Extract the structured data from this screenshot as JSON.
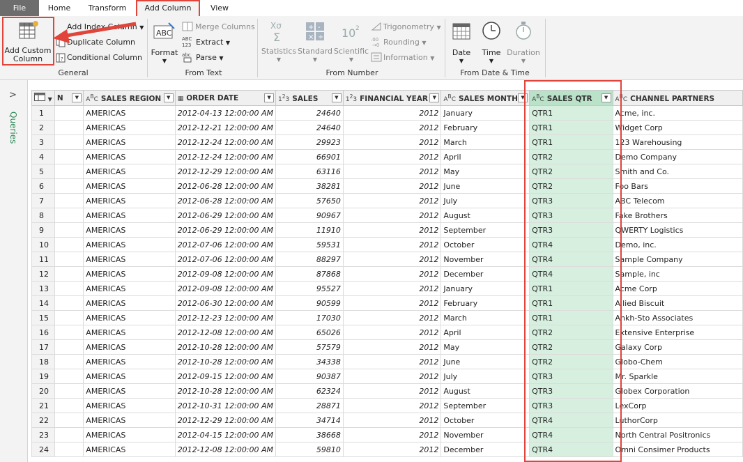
{
  "tabs": {
    "file": "File",
    "home": "Home",
    "transform": "Transform",
    "add_column": "Add Column",
    "view": "View"
  },
  "ribbon": {
    "general": {
      "label": "General",
      "add_custom_column": [
        "Add Custom",
        "Column"
      ],
      "index_column": "Add Index Column",
      "duplicate_column": "Duplicate Column",
      "conditional_column": "Conditional Column"
    },
    "from_text": {
      "label": "From Text",
      "format": "Format",
      "merge_columns": "Merge Columns",
      "extract": "Extract",
      "parse": "Parse"
    },
    "from_number": {
      "label": "From Number",
      "statistics": "Statistics",
      "standard": "Standard",
      "scientific": "Scientific",
      "trigonometry": "Trigonometry",
      "rounding": "Rounding",
      "information": "Information"
    },
    "from_datetime": {
      "label": "From Date & Time",
      "date": "Date",
      "time": "Time",
      "duration": "Duration"
    }
  },
  "queries_label": "Queries",
  "columns": [
    "N",
    "SALES REGION",
    "ORDER DATE",
    "SALES",
    "FINANCIAL YEAR",
    "SALES MONTH",
    "SALES QTR",
    "CHANNEL PARTNERS"
  ],
  "rows": [
    [
      "1",
      "AMERICAS",
      "2012-04-13 12:00:00 AM",
      "24640",
      "2012",
      "January",
      "QTR1",
      "Acme, inc."
    ],
    [
      "2",
      "AMERICAS",
      "2012-12-21 12:00:00 AM",
      "24640",
      "2012",
      "February",
      "QTR1",
      "Widget Corp"
    ],
    [
      "3",
      "AMERICAS",
      "2012-12-24 12:00:00 AM",
      "29923",
      "2012",
      "March",
      "QTR1",
      "123 Warehousing"
    ],
    [
      "4",
      "AMERICAS",
      "2012-12-24 12:00:00 AM",
      "66901",
      "2012",
      "April",
      "QTR2",
      "Demo Company"
    ],
    [
      "5",
      "AMERICAS",
      "2012-12-29 12:00:00 AM",
      "63116",
      "2012",
      "May",
      "QTR2",
      "Smith and Co."
    ],
    [
      "6",
      "AMERICAS",
      "2012-06-28 12:00:00 AM",
      "38281",
      "2012",
      "June",
      "QTR2",
      "Foo Bars"
    ],
    [
      "7",
      "AMERICAS",
      "2012-06-28 12:00:00 AM",
      "57650",
      "2012",
      "July",
      "QTR3",
      "ABC Telecom"
    ],
    [
      "8",
      "AMERICAS",
      "2012-06-29 12:00:00 AM",
      "90967",
      "2012",
      "August",
      "QTR3",
      "Fake Brothers"
    ],
    [
      "9",
      "AMERICAS",
      "2012-06-29 12:00:00 AM",
      "11910",
      "2012",
      "September",
      "QTR3",
      "QWERTY Logistics"
    ],
    [
      "10",
      "AMERICAS",
      "2012-07-06 12:00:00 AM",
      "59531",
      "2012",
      "October",
      "QTR4",
      "Demo, inc."
    ],
    [
      "11",
      "AMERICAS",
      "2012-07-06 12:00:00 AM",
      "88297",
      "2012",
      "November",
      "QTR4",
      "Sample Company"
    ],
    [
      "12",
      "AMERICAS",
      "2012-09-08 12:00:00 AM",
      "87868",
      "2012",
      "December",
      "QTR4",
      "Sample, inc"
    ],
    [
      "13",
      "AMERICAS",
      "2012-09-08 12:00:00 AM",
      "95527",
      "2012",
      "January",
      "QTR1",
      "Acme Corp"
    ],
    [
      "14",
      "AMERICAS",
      "2012-06-30 12:00:00 AM",
      "90599",
      "2012",
      "February",
      "QTR1",
      "Allied Biscuit"
    ],
    [
      "15",
      "AMERICAS",
      "2012-12-23 12:00:00 AM",
      "17030",
      "2012",
      "March",
      "QTR1",
      "Ankh-Sto Associates"
    ],
    [
      "16",
      "AMERICAS",
      "2012-12-08 12:00:00 AM",
      "65026",
      "2012",
      "April",
      "QTR2",
      "Extensive Enterprise"
    ],
    [
      "17",
      "AMERICAS",
      "2012-10-28 12:00:00 AM",
      "57579",
      "2012",
      "May",
      "QTR2",
      "Galaxy Corp"
    ],
    [
      "18",
      "AMERICAS",
      "2012-10-28 12:00:00 AM",
      "34338",
      "2012",
      "June",
      "QTR2",
      "Globo-Chem"
    ],
    [
      "19",
      "AMERICAS",
      "2012-09-15 12:00:00 AM",
      "90387",
      "2012",
      "July",
      "QTR3",
      "Mr. Sparkle"
    ],
    [
      "20",
      "AMERICAS",
      "2012-10-28 12:00:00 AM",
      "62324",
      "2012",
      "August",
      "QTR3",
      "Globex Corporation"
    ],
    [
      "21",
      "AMERICAS",
      "2012-10-31 12:00:00 AM",
      "28871",
      "2012",
      "September",
      "QTR3",
      "LexCorp"
    ],
    [
      "22",
      "AMERICAS",
      "2012-12-29 12:00:00 AM",
      "34714",
      "2012",
      "October",
      "QTR4",
      "LuthorCorp"
    ],
    [
      "23",
      "AMERICAS",
      "2012-04-15 12:00:00 AM",
      "38668",
      "2012",
      "November",
      "QTR4",
      "North Central Positronics"
    ],
    [
      "24",
      "AMERICAS",
      "2012-12-08 12:00:00 AM",
      "59810",
      "2012",
      "December",
      "QTR4",
      "Omni Consimer Products"
    ]
  ],
  "colors": {
    "highlight": "#e0443a",
    "selected_column": "#d6efdf",
    "file_tab": "#6d6d6d"
  }
}
